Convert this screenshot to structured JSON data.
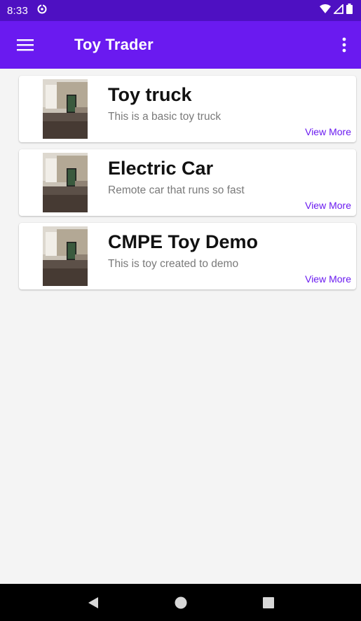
{
  "status_bar": {
    "time": "8:33",
    "icons": [
      "data-saver-icon",
      "wifi-icon",
      "cell-signal-icon",
      "battery-icon"
    ]
  },
  "app_bar": {
    "title": "Toy Trader",
    "menu_icon": "hamburger-menu-icon",
    "overflow_icon": "more-vert-icon",
    "color": "#6a1af0",
    "status_color": "#4e10c2"
  },
  "toys": [
    {
      "title": "Toy truck",
      "description": "This is a basic toy truck",
      "action": "View More"
    },
    {
      "title": "Electric Car",
      "description": "Remote car that runs so fast",
      "action": "View More"
    },
    {
      "title": "CMPE Toy Demo",
      "description": "This is toy created to demo",
      "action": "View More"
    }
  ],
  "nav_bar": {
    "icons": [
      "back-icon",
      "home-icon",
      "recents-icon"
    ]
  }
}
